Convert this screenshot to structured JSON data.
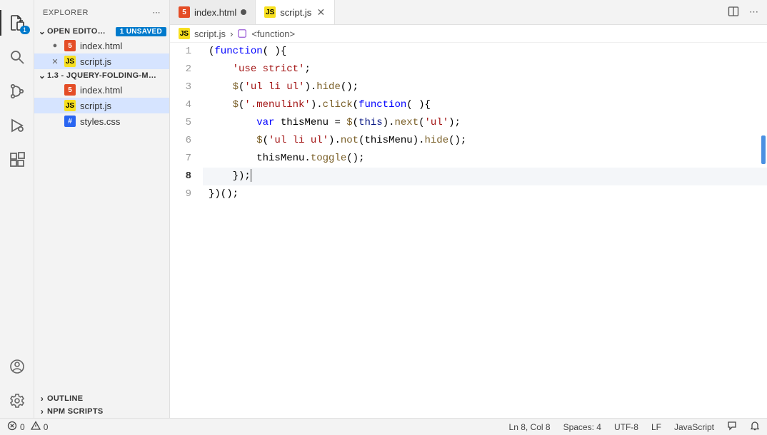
{
  "sidebar": {
    "title": "EXPLORER",
    "sections": {
      "openEditors": {
        "label": "OPEN EDITO…",
        "unsaved": "1 UNSAVED",
        "items": [
          {
            "pre": "●",
            "icon": "html",
            "label": "index.html"
          },
          {
            "pre": "✕",
            "icon": "js",
            "label": "script.js"
          }
        ]
      },
      "folder": {
        "label": "1.3 - JQUERY-FOLDING-M…",
        "items": [
          {
            "icon": "html",
            "label": "index.html"
          },
          {
            "icon": "js",
            "label": "script.js"
          },
          {
            "icon": "css",
            "label": "styles.css"
          }
        ]
      },
      "outline": {
        "label": "OUTLINE"
      },
      "npm": {
        "label": "NPM SCRIPTS"
      }
    }
  },
  "tabs": [
    {
      "icon": "html",
      "label": "index.html",
      "dirty": true
    },
    {
      "icon": "js",
      "label": "script.js",
      "active": true
    }
  ],
  "breadcrumb": {
    "file": "script.js",
    "symbol": "<function>"
  },
  "activityBadge": "1",
  "code": {
    "lines": [
      {
        "n": 1,
        "tokens": [
          [
            "p",
            "("
          ],
          [
            "k",
            "function"
          ],
          [
            "p",
            "( ){"
          ]
        ]
      },
      {
        "n": 2,
        "indent": 2,
        "tokens": [
          [
            "s",
            "'use strict'"
          ],
          [
            "p",
            ";"
          ]
        ]
      },
      {
        "n": 3,
        "indent": 2,
        "tokens": [
          [
            "f",
            "$"
          ],
          [
            "p",
            "("
          ],
          [
            "s",
            "'ul li ul'"
          ],
          [
            "p",
            ")."
          ],
          [
            "f",
            "hide"
          ],
          [
            "p",
            "();"
          ]
        ]
      },
      {
        "n": 4,
        "indent": 2,
        "tokens": [
          [
            "f",
            "$"
          ],
          [
            "p",
            "("
          ],
          [
            "s",
            "'.menulink'"
          ],
          [
            "p",
            ")."
          ],
          [
            "f",
            "click"
          ],
          [
            "p",
            "("
          ],
          [
            "k",
            "function"
          ],
          [
            "p",
            "( ){"
          ]
        ]
      },
      {
        "n": 5,
        "indent": 4,
        "tokens": [
          [
            "k",
            "var"
          ],
          [
            "n",
            " thisMenu = "
          ],
          [
            "f",
            "$"
          ],
          [
            "p",
            "("
          ],
          [
            "v",
            "this"
          ],
          [
            "p",
            ")."
          ],
          [
            "f",
            "next"
          ],
          [
            "p",
            "("
          ],
          [
            "s",
            "'ul'"
          ],
          [
            "p",
            ");"
          ]
        ]
      },
      {
        "n": 6,
        "indent": 4,
        "tokens": [
          [
            "f",
            "$"
          ],
          [
            "p",
            "("
          ],
          [
            "s",
            "'ul li ul'"
          ],
          [
            "p",
            ")."
          ],
          [
            "f",
            "not"
          ],
          [
            "p",
            "(thisMenu)."
          ],
          [
            "f",
            "hide"
          ],
          [
            "p",
            "();"
          ]
        ]
      },
      {
        "n": 7,
        "indent": 4,
        "tokens": [
          [
            "n",
            "thisMenu."
          ],
          [
            "f",
            "toggle"
          ],
          [
            "p",
            "();"
          ]
        ]
      },
      {
        "n": 8,
        "indent": 2,
        "tokens": [
          [
            "p",
            "});"
          ]
        ],
        "current": true,
        "cursor": true
      },
      {
        "n": 9,
        "tokens": [
          [
            "p",
            "})();"
          ]
        ]
      }
    ]
  },
  "status": {
    "errors": "0",
    "warnings": "0",
    "position": "Ln 8, Col 8",
    "spaces": "Spaces: 4",
    "encoding": "UTF-8",
    "eol": "LF",
    "language": "JavaScript"
  }
}
